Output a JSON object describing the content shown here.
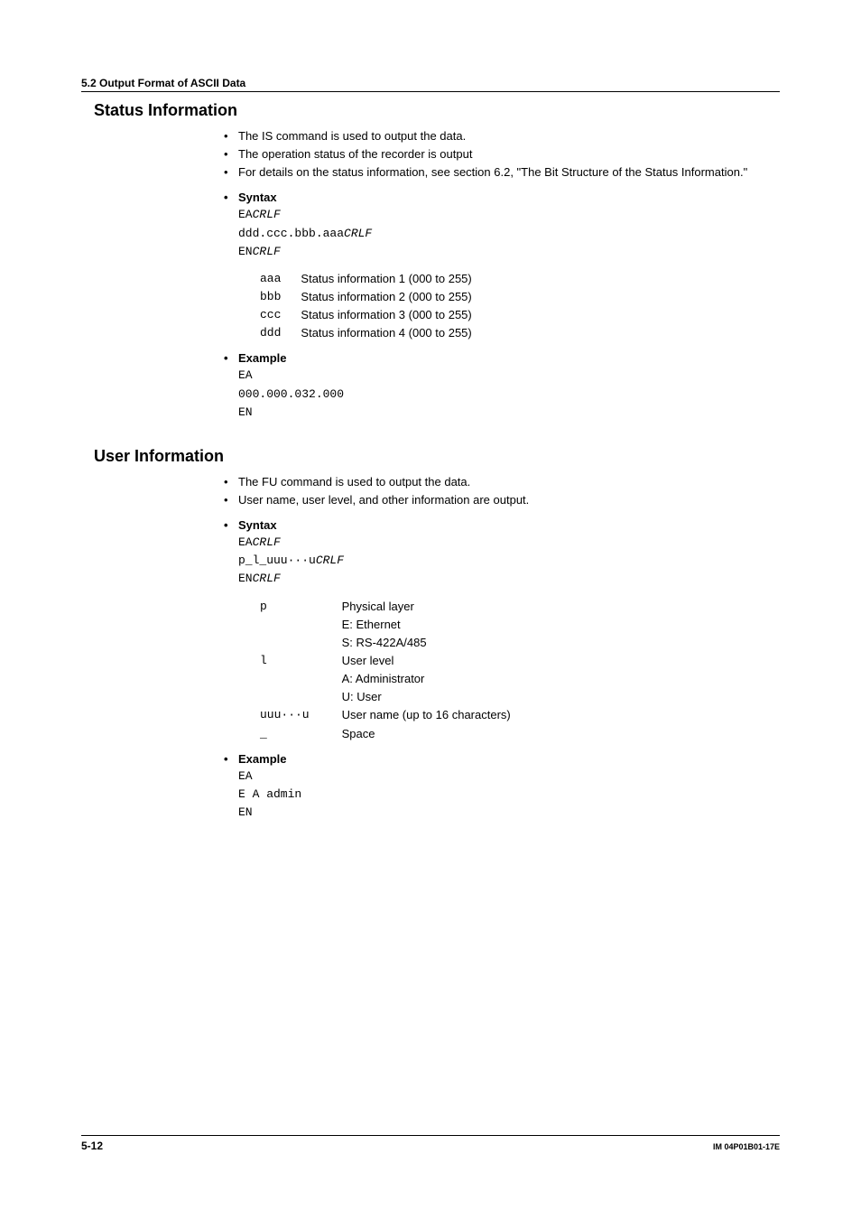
{
  "header": {
    "section_title": "5.2  Output Format of ASCII Data"
  },
  "status_info": {
    "heading": "Status Information",
    "bullets": [
      "The IS command is used to output the data.",
      "The operation status of the recorder is output",
      "For details on the status information, see section 6.2, \"The Bit Structure of the Status Information.\""
    ],
    "syntax": {
      "heading": "Syntax",
      "line1a": "EA",
      "line1b": "CRLF",
      "line2a": "ddd.ccc.bbb.aaa",
      "line2b": "CRLF",
      "line3a": "EN",
      "line3b": "CRLF",
      "params": [
        {
          "name": "aaa",
          "desc": "Status information 1 (000 to 255)"
        },
        {
          "name": "bbb",
          "desc": "Status information 2 (000 to 255)"
        },
        {
          "name": "ccc",
          "desc": "Status information 3 (000 to 255)"
        },
        {
          "name": "ddd",
          "desc": "Status information 4 (000 to 255)"
        }
      ]
    },
    "example": {
      "heading": "Example",
      "line1": "EA",
      "line2": "000.000.032.000",
      "line3": "EN"
    }
  },
  "user_info": {
    "heading": "User Information",
    "bullets": [
      "The FU command is used to output the data.",
      "User name, user level, and other information are output."
    ],
    "syntax": {
      "heading": "Syntax",
      "line1a": "EA",
      "line1b": "CRLF",
      "line2a": "p_l_uuu···u",
      "line2b": "CRLF",
      "line3a": "EN",
      "line3b": "CRLF",
      "params": [
        {
          "name": "p",
          "desc": "Physical layer"
        },
        {
          "name": "",
          "desc": "E: Ethernet"
        },
        {
          "name": "",
          "desc": "S: RS-422A/485"
        },
        {
          "name": "l",
          "desc": "User level"
        },
        {
          "name": "",
          "desc": "A: Administrator"
        },
        {
          "name": "",
          "desc": "U: User"
        },
        {
          "name": "uuu···u",
          "desc": "User name (up to 16 characters)"
        },
        {
          "name": "_",
          "desc": "Space"
        }
      ]
    },
    "example": {
      "heading": "Example",
      "line1": "EA",
      "line2": "E A admin",
      "line3": "EN"
    }
  },
  "footer": {
    "page": "5-12",
    "doc_code": "IM 04P01B01-17E"
  }
}
